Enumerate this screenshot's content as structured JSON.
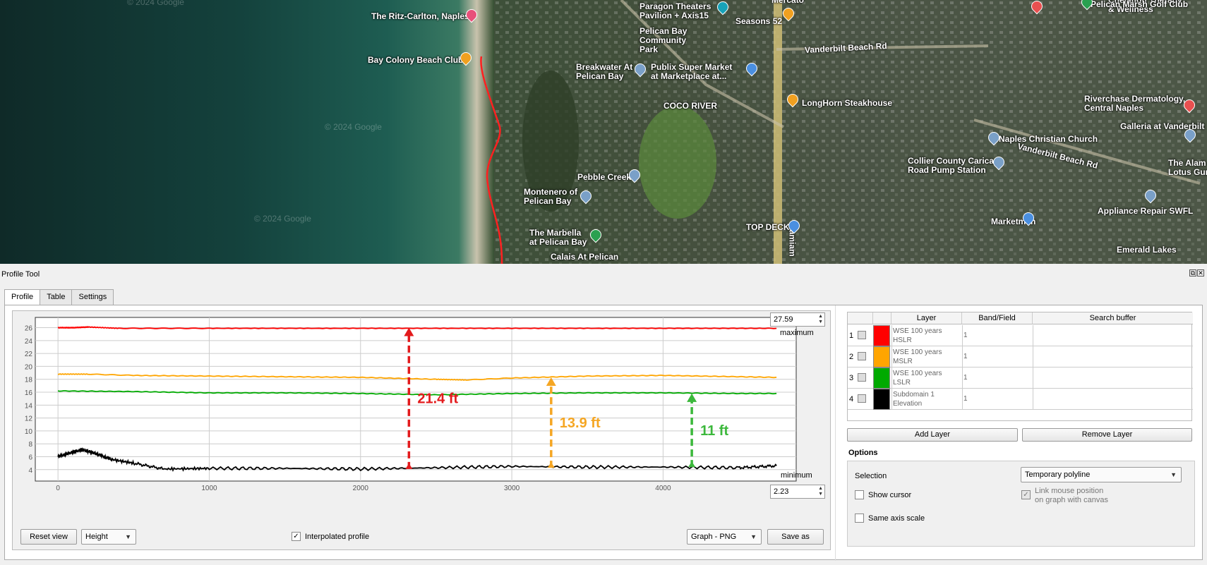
{
  "map": {
    "labels": [
      {
        "name": "ritz",
        "text": "The Ritz-Carlton, Naples"
      },
      {
        "name": "bay-colony",
        "text": "Bay Colony Beach Club"
      },
      {
        "name": "paragon",
        "text": "Paragon Theaters\nPavilion + Axis15"
      },
      {
        "name": "pelican-park",
        "text": "Pelican Bay\nCommunity\nPark"
      },
      {
        "name": "seasons",
        "text": "Seasons 52"
      },
      {
        "name": "mercato",
        "text": "Mercato"
      },
      {
        "name": "vanderbilt-1",
        "text": "Vanderbilt Beach Rd"
      },
      {
        "name": "breakwater",
        "text": "Breakwater At\nPelican Bay"
      },
      {
        "name": "publix",
        "text": "Publix Super Market\nat Marketplace at..."
      },
      {
        "name": "coco",
        "text": "COCO RIVER"
      },
      {
        "name": "longhorn",
        "text": "LongHorn Steakhouse"
      },
      {
        "name": "pebble",
        "text": "Pebble Creek"
      },
      {
        "name": "montenero",
        "text": "Montenero of\nPelican Bay"
      },
      {
        "name": "marbella",
        "text": "The Marbella\nat Pelican Bay"
      },
      {
        "name": "calais",
        "text": "Calais At Pelican"
      },
      {
        "name": "topdeck",
        "text": "TOP DECK"
      },
      {
        "name": "tamiami",
        "text": "Tamiam"
      },
      {
        "name": "chelation",
        "text": "Chelation Therapy\n& Wellness"
      },
      {
        "name": "pelican-marsh",
        "text": "Pelican Marsh Golf Club"
      },
      {
        "name": "riverchase",
        "text": "Riverchase Dermatology,\nCentral Naples"
      },
      {
        "name": "galleria",
        "text": "Galleria at Vanderbilt"
      },
      {
        "name": "christian",
        "text": "Naples Christian Church"
      },
      {
        "name": "carica",
        "text": "Collier County Carica\nRoad Pump Station"
      },
      {
        "name": "vanderbilt-2",
        "text": "Vanderbilt Beach Rd"
      },
      {
        "name": "alam",
        "text": "The Alam\nLotus Gunw"
      },
      {
        "name": "appliance",
        "text": "Appliance Repair SWFL"
      },
      {
        "name": "marketmen",
        "text": "Marketmen"
      },
      {
        "name": "emerald",
        "text": "Emerald Lakes"
      }
    ],
    "watermarks": [
      "© 2024 Google",
      "© 2024 Google",
      "© 2024 Google",
      "© 2024 Google"
    ]
  },
  "panel": {
    "title": "Profile Tool",
    "tabs": [
      "Profile",
      "Table",
      "Settings"
    ],
    "max_value": "27.59",
    "max_label": "maximum",
    "min_label": "minimum",
    "min_value": "2.23",
    "reset_button": "Reset view",
    "axis_mode": "Height",
    "interpolated_label": "Interpolated profile",
    "interpolated_checked": true,
    "export_format": "Graph - PNG",
    "save_button": "Save as"
  },
  "layers": {
    "headers": [
      "Layer",
      "Band/Field",
      "Search buffer"
    ],
    "rows": [
      {
        "num": "1",
        "color": "#ff0000",
        "name": "WSE 100 years HSLR",
        "band": "1"
      },
      {
        "num": "2",
        "color": "#ffa500",
        "name": "WSE 100 years MSLR",
        "band": "1"
      },
      {
        "num": "3",
        "color": "#00aa00",
        "name": "WSE 100 years LSLR",
        "band": "1"
      },
      {
        "num": "4",
        "color": "#000000",
        "name": "Subdomain 1 Elevation",
        "band": "1"
      }
    ],
    "add_button": "Add Layer",
    "remove_button": "Remove Layer"
  },
  "options": {
    "title": "Options",
    "selection_label": "Selection",
    "selection_value": "Temporary polyline",
    "show_cursor": "Show cursor",
    "link_mouse": "Link mouse position\non graph with canvas",
    "same_axis": "Same axis scale"
  },
  "chart_data": {
    "type": "line",
    "xlim": [
      -150,
      4880
    ],
    "ylim": [
      2.23,
      27.59
    ],
    "x_ticks": [
      0,
      1000,
      2000,
      3000,
      4000
    ],
    "y_ticks": [
      4,
      6,
      8,
      10,
      12,
      14,
      16,
      18,
      20,
      22,
      24,
      26
    ],
    "grid": true,
    "series": [
      {
        "name": "WSE 100 years HSLR",
        "color": "#ff0000",
        "x": [
          0,
          100,
          200,
          400,
          1000,
          2000,
          3000,
          4000,
          4750
        ],
        "y": [
          26.0,
          26.0,
          26.1,
          25.9,
          25.9,
          25.9,
          25.9,
          25.9,
          25.9
        ]
      },
      {
        "name": "WSE 100 years MSLR",
        "color": "#ffa500",
        "x": [
          0,
          200,
          500,
          1000,
          1500,
          2000,
          2500,
          2700,
          3000,
          3500,
          4000,
          4500,
          4750
        ],
        "y": [
          18.8,
          18.8,
          18.6,
          18.5,
          18.4,
          18.3,
          18.0,
          17.9,
          18.2,
          18.5,
          18.6,
          18.4,
          18.3
        ]
      },
      {
        "name": "WSE 100 years LSLR",
        "color": "#00aa00",
        "x": [
          0,
          500,
          1000,
          1500,
          2000,
          2500,
          3000,
          3500,
          4000,
          4500,
          4750
        ],
        "y": [
          16.2,
          16.1,
          15.9,
          15.9,
          15.8,
          15.6,
          15.8,
          15.9,
          15.9,
          15.8,
          15.8
        ]
      },
      {
        "name": "Subdomain 1 Elevation",
        "color": "#000000",
        "x": [
          0,
          80,
          160,
          250,
          350,
          500,
          700,
          1000,
          1500,
          2000,
          2500,
          3000,
          3500,
          4000,
          4500,
          4750
        ],
        "y": [
          6.0,
          6.6,
          7.1,
          6.5,
          5.6,
          5.0,
          4.1,
          4.2,
          4.2,
          4.1,
          4.3,
          4.5,
          4.4,
          4.4,
          4.3,
          4.6
        ]
      }
    ],
    "annotations": [
      {
        "text": "21.4 ft",
        "color": "#e31a1c",
        "x": 2320,
        "y_from": 4.1,
        "y_to": 26.0
      },
      {
        "text": "13.9 ft",
        "color": "#f5a623",
        "x": 3260,
        "y_from": 4.3,
        "y_to": 18.3
      },
      {
        "text": "11 ft",
        "color": "#3cb83c",
        "x": 4190,
        "y_from": 4.4,
        "y_to": 15.8
      }
    ]
  }
}
